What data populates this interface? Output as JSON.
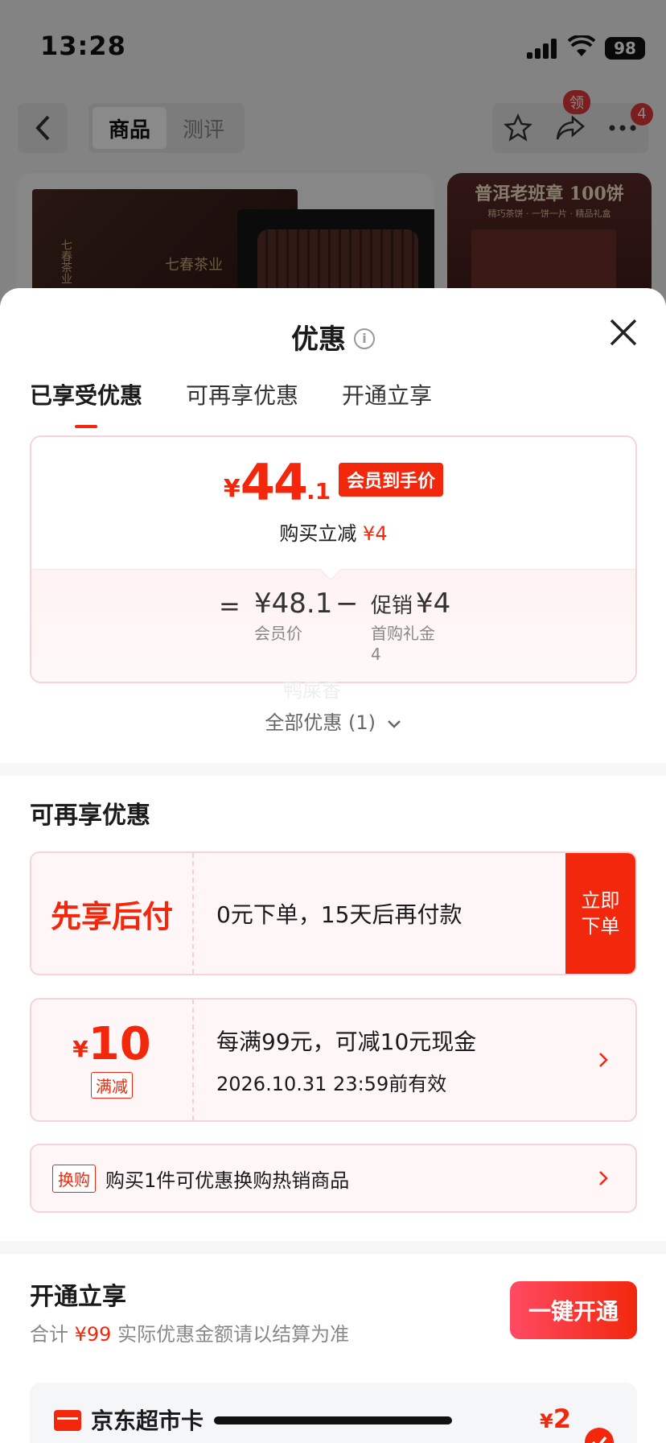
{
  "status_bar": {
    "time": "13:28",
    "battery": "98"
  },
  "background_nav": {
    "tabs": [
      "商品",
      "测评"
    ],
    "badge_ling": "领",
    "badge_count": "4"
  },
  "background_products": {
    "box_brand": "七春茶业",
    "box_side": "七春茶业",
    "img2_title": "普洱老班章 100饼",
    "img2_sub": "精巧茶饼 · 一饼一片 · 精品礼盒"
  },
  "sheet": {
    "title": "优惠",
    "tabs": [
      "已享受优惠",
      "可再享优惠",
      "开通立享"
    ],
    "active_tab": 0
  },
  "price_card": {
    "yen": "¥",
    "price_int": "44",
    "price_dec": ".1",
    "member_tag": "会员到手价",
    "sub_prefix": "购买立减",
    "sub_amount": "¥4",
    "eq": "=",
    "member_price": "¥48.1",
    "member_price_label": "会员价",
    "minus": "−",
    "promo_label": "促销",
    "promo_amount": "¥4",
    "promo_detail": "首购礼金",
    "promo_detail_value": "4"
  },
  "watermark": "鸭屎香",
  "all_offers": "全部优惠 (1)",
  "more_offers": {
    "title": "可再享优惠",
    "bnpl": {
      "label": "先享后付",
      "text": "0元下单，15天后再付款",
      "cta_line1": "立即",
      "cta_line2": "下单"
    },
    "coupon": {
      "yen": "¥",
      "amount": "10",
      "tag": "满减",
      "text": "每满99元，可减10元现金",
      "validity": "2026.10.31 23:59前有效"
    },
    "exchange": {
      "tag": "换购",
      "text": "购买1件可优惠换购热销商品"
    }
  },
  "open_section": {
    "title": "开通立享",
    "sub_prefix": "合计",
    "sub_amount": "¥99",
    "sub_suffix": "实际优惠金额请以结算为准",
    "button": "一键开通",
    "card_name": "京东超市卡",
    "card_yen": "¥",
    "card_price": "2"
  },
  "colors": {
    "accent": "#f2270c",
    "card_border": "#f7d3d7",
    "card_bg": "#fff7f7"
  }
}
